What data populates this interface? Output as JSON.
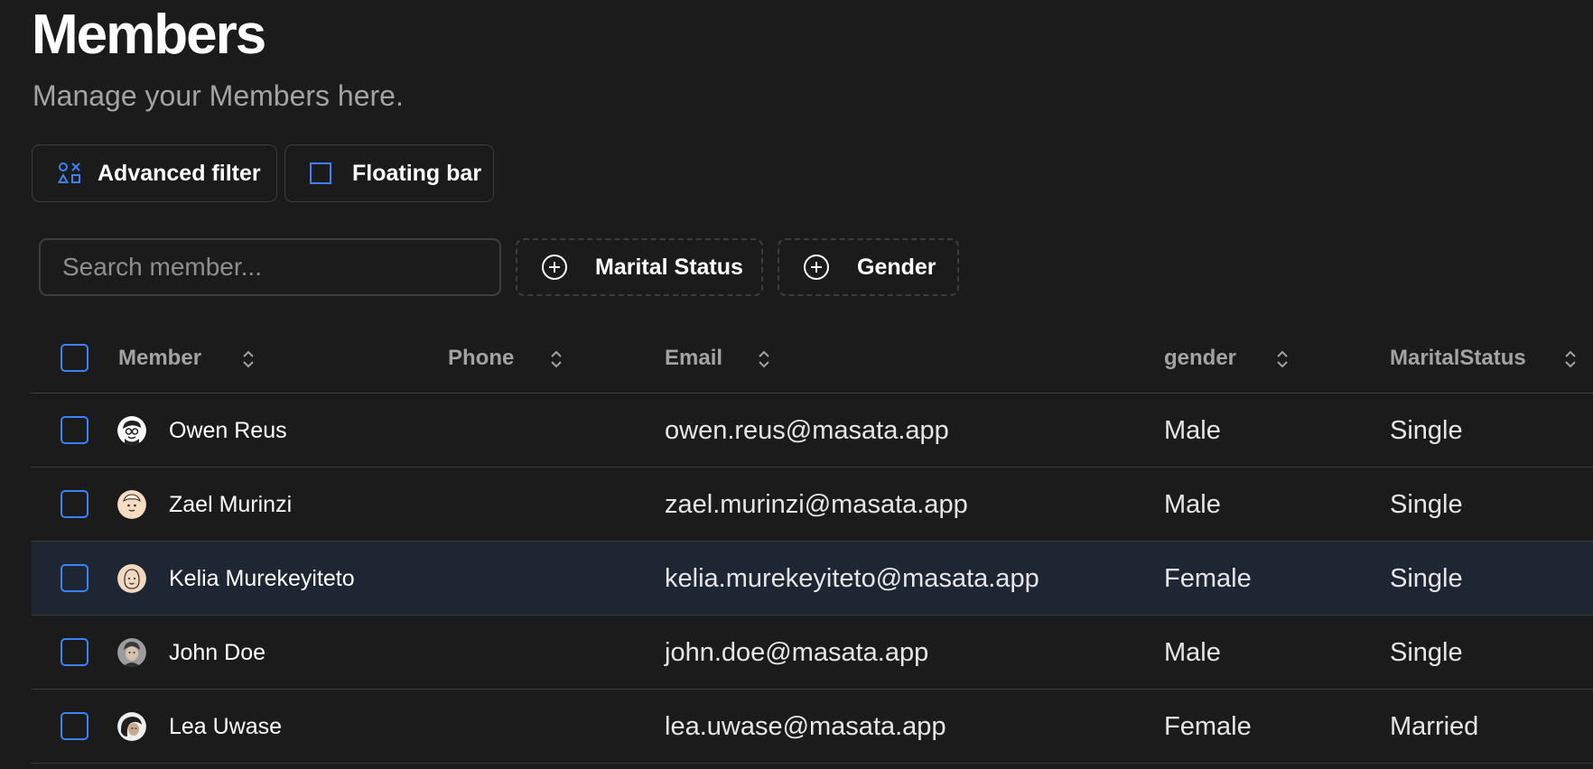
{
  "header": {
    "title": "Members",
    "subtitle": "Manage your Members here."
  },
  "toolbar": {
    "advanced_filter_label": "Advanced filter",
    "floating_bar_label": "Floating bar"
  },
  "filters": {
    "search_placeholder": "Search member...",
    "marital_status_label": "Marital Status",
    "gender_label": "Gender"
  },
  "table": {
    "columns": {
      "member": "Member",
      "phone": "Phone",
      "email": "Email",
      "gender": "gender",
      "marital_status": "MaritalStatus"
    },
    "rows": [
      {
        "name": "Owen Reus",
        "phone": "",
        "email": "owen.reus@masata.app",
        "gender": "Male",
        "marital_status": "Single"
      },
      {
        "name": "Zael Murinzi",
        "phone": "",
        "email": "zael.murinzi@masata.app",
        "gender": "Male",
        "marital_status": "Single"
      },
      {
        "name": "Kelia Murekeyiteto",
        "phone": "",
        "email": "kelia.murekeyiteto@masata.app",
        "gender": "Female",
        "marital_status": "Single"
      },
      {
        "name": "John Doe",
        "phone": "",
        "email": "john.doe@masata.app",
        "gender": "Male",
        "marital_status": "Single"
      },
      {
        "name": "Lea Uwase",
        "phone": "",
        "email": "lea.uwase@masata.app",
        "gender": "Female",
        "marital_status": "Married"
      }
    ]
  },
  "colors": {
    "background": "#1b1b1b",
    "accent": "#3b82f6",
    "row_highlight": "#1e2633",
    "muted_text": "#a3a3a3"
  },
  "icons": {
    "advanced_filter": "shapes-icon",
    "floating_bar": "square-icon",
    "facet": "plus-circle-icon",
    "sort": "chevron-up-down-icon"
  }
}
